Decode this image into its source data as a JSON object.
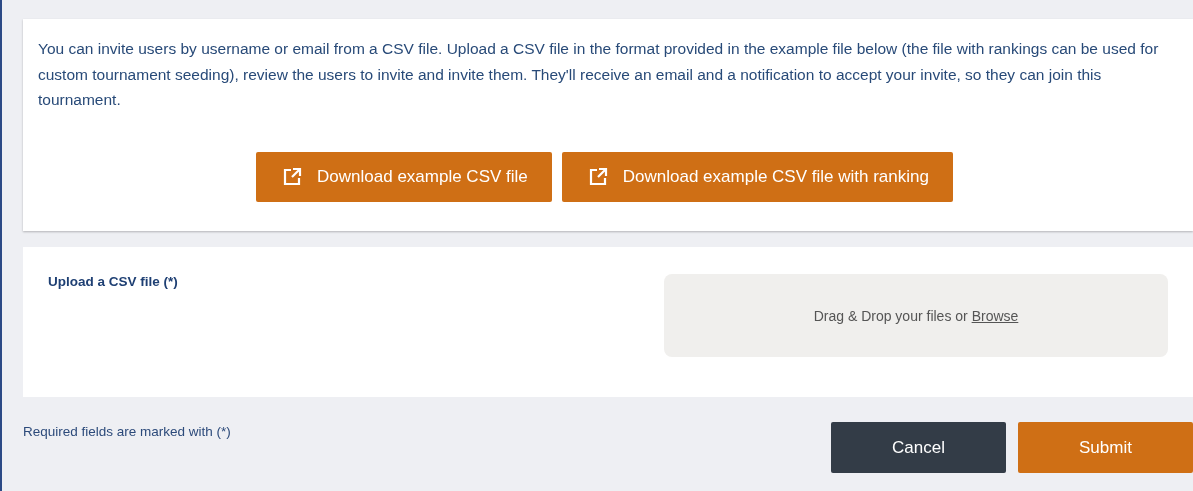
{
  "intro": {
    "text": "You can invite users by username or email from a CSV file. Upload a CSV file in the format provided in the example file below (the file with rankings can be used for custom tournament seeding), review the users to invite and invite them. They'll receive an email and a notification to accept your invite, so they can join this tournament."
  },
  "downloads": [
    {
      "label": "Download example CSV file"
    },
    {
      "label": "Download example CSV file with ranking"
    }
  ],
  "upload": {
    "label": "Upload a CSV file (*)",
    "dropzone_text": "Drag & Drop your files or",
    "dropzone_link": "Browse"
  },
  "footer_note": "Required fields are marked with (*)",
  "actions": [
    {
      "label": "Cancel",
      "kind": "secondary"
    },
    {
      "label": "Submit",
      "kind": "primary"
    }
  ]
}
